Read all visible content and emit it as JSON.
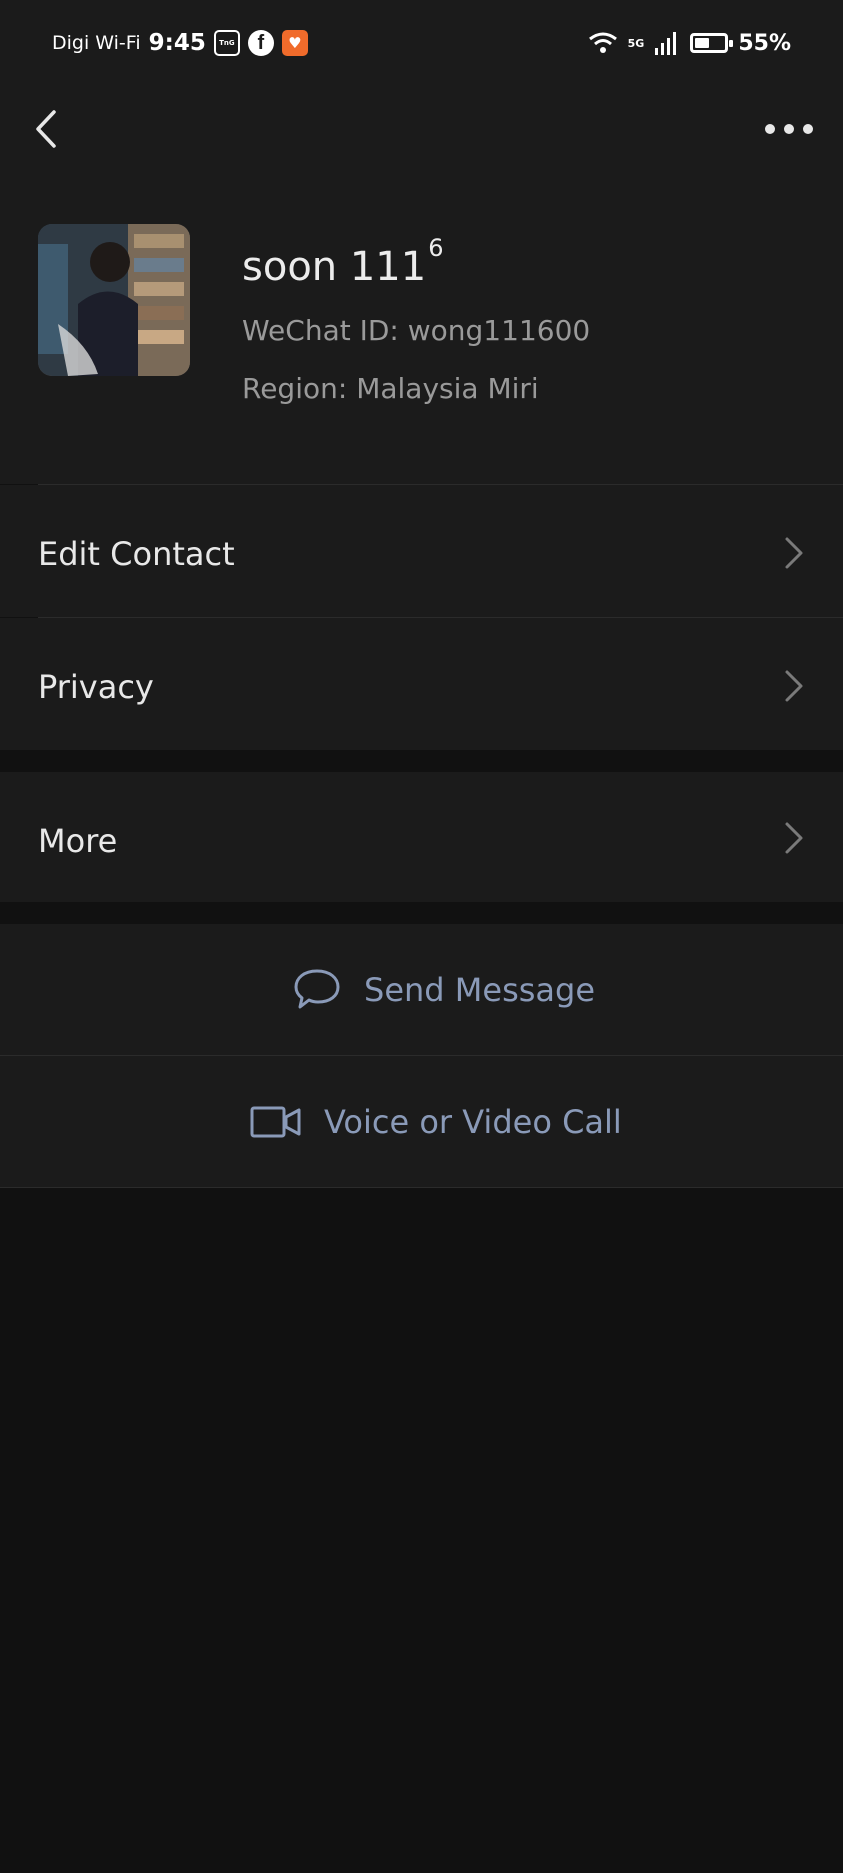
{
  "status_bar": {
    "carrier": "Digi Wi-Fi",
    "time": "9:45",
    "apps": [
      {
        "icon": "touch-n-go-icon",
        "text": "Touch 'n Go eWallet"
      },
      {
        "icon": "facebook-icon",
        "text": "f"
      },
      {
        "icon": "shopee-icon",
        "text": "♥"
      }
    ],
    "network": "5G",
    "battery_percent": "55%",
    "battery_level": 0.55
  },
  "nav": {
    "back_icon": "chevron-left-icon",
    "more_icon": "more-dots-icon"
  },
  "profile": {
    "name": "soon 111",
    "name_superscript": "6",
    "wechat_id": "WeChat ID: wong111600",
    "region": "Region: Malaysia Miri"
  },
  "menu": {
    "edit_contact": "Edit Contact",
    "privacy": "Privacy",
    "more": "More"
  },
  "actions": {
    "send_message": "Send Message",
    "voice_video_call": "Voice or Video Call"
  },
  "colors": {
    "background": "#111111",
    "surface": "#1b1b1b",
    "action_text": "#8a9ab8",
    "secondary_text": "#9a9a9a"
  }
}
